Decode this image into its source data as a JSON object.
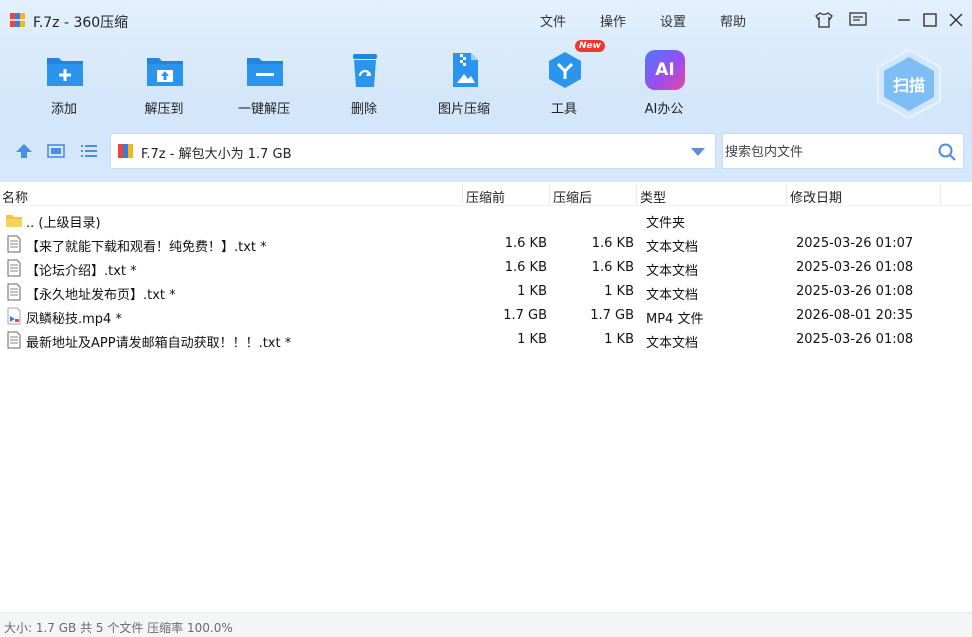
{
  "window": {
    "title": "F.7z - 360压缩"
  },
  "menu": {
    "file": "文件",
    "operate": "操作",
    "settings": "设置",
    "help": "帮助"
  },
  "toolbar": {
    "add": "添加",
    "extract_to": "解压到",
    "one_click_extract": "一键解压",
    "delete": "删除",
    "image_compress": "图片压缩",
    "tools": "工具",
    "tools_badge": "New",
    "ai_office": "AI办公",
    "ai_logo": "AI",
    "scan": "扫描"
  },
  "path": {
    "text": "F.7z - 解包大小为 1.7 GB"
  },
  "search": {
    "placeholder": "搜索包内文件"
  },
  "columns": {
    "name": "名称",
    "before": "压缩前",
    "after": "压缩后",
    "type": "类型",
    "date": "修改日期"
  },
  "rows": [
    {
      "name": ".. (上级目录)",
      "before": "",
      "after": "",
      "type": "文件夹",
      "date": "",
      "icon": "folder-icon"
    },
    {
      "name": "【来了就能下载和观看！纯免费！】.txt *",
      "before": "1.6 KB",
      "after": "1.6 KB",
      "type": "文本文档",
      "date": "2025-03-26 01:07",
      "icon": "text-file-icon"
    },
    {
      "name": "【论坛介绍】.txt *",
      "before": "1.6 KB",
      "after": "1.6 KB",
      "type": "文本文档",
      "date": "2025-03-26 01:08",
      "icon": "text-file-icon"
    },
    {
      "name": "【永久地址发布页】.txt *",
      "before": "1 KB",
      "after": "1 KB",
      "type": "文本文档",
      "date": "2025-03-26 01:08",
      "icon": "text-file-icon"
    },
    {
      "name": "凤鳞秘技.mp4 *",
      "before": "1.7 GB",
      "after": "1.7 GB",
      "type": "MP4 文件",
      "date": "2026-08-01 20:35",
      "icon": "video-file-icon"
    },
    {
      "name": "最新地址及APP请发邮箱自动获取！！！.txt *",
      "before": "1 KB",
      "after": "1 KB",
      "type": "文本文档",
      "date": "2025-03-26 01:08",
      "icon": "text-file-icon"
    }
  ],
  "status": {
    "text": "大小: 1.7 GB 共 5 个文件 压缩率 100.0%"
  }
}
